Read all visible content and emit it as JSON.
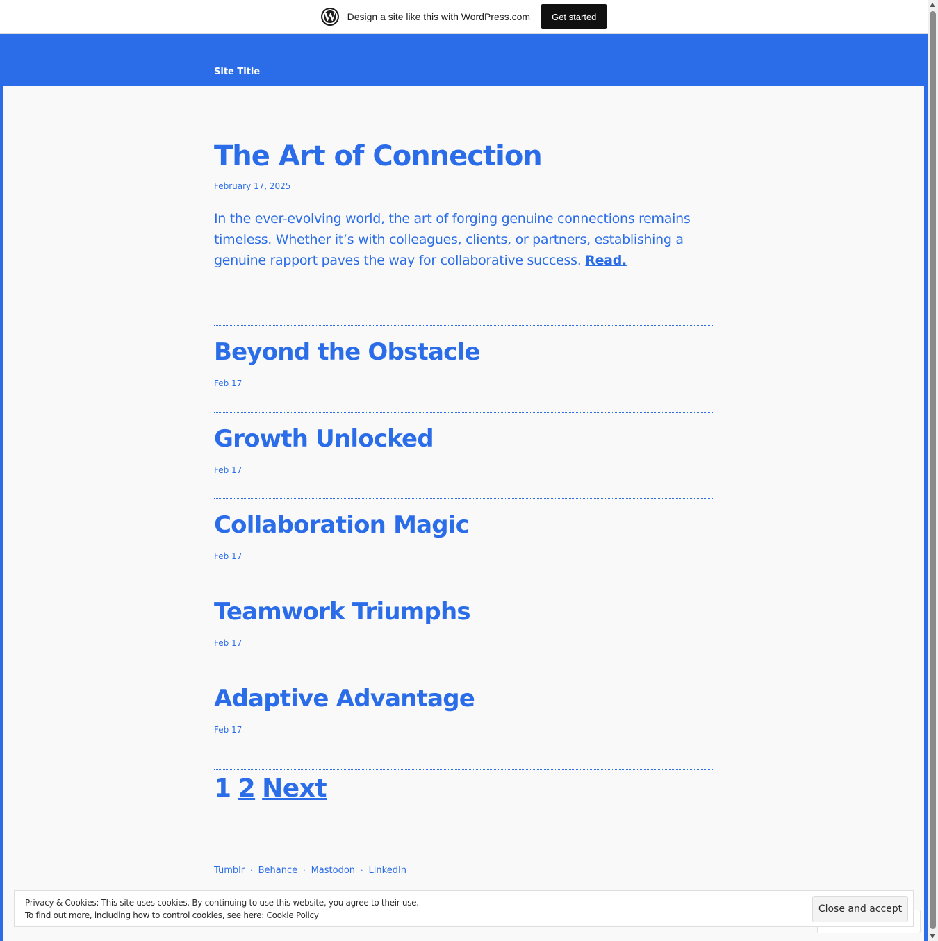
{
  "promo_bar": {
    "text": "Design a site like this with WordPress.com",
    "button_label": "Get started",
    "logo_glyph": "W"
  },
  "header": {
    "site_title": "Site Title"
  },
  "featured": {
    "title": "The Art of Connection",
    "date": "February 17, 2025",
    "excerpt": "In the ever-evolving world, the art of forging genuine connections remains timeless. Whether it’s with colleagues, clients, or partners, establishing a genuine rapport paves the way for collaborative success.",
    "read_label": "Read."
  },
  "posts": [
    {
      "title": "Beyond the Obstacle",
      "date": "Feb 17"
    },
    {
      "title": "Growth Unlocked",
      "date": "Feb 17"
    },
    {
      "title": "Collaboration Magic",
      "date": "Feb 17"
    },
    {
      "title": "Teamwork Triumphs",
      "date": "Feb 17"
    },
    {
      "title": "Adaptive Advantage",
      "date": "Feb 17"
    }
  ],
  "pagination": {
    "current": "1",
    "page2": "2",
    "next": "Next"
  },
  "social": {
    "links": [
      "Tumblr",
      "Behance",
      "Mastodon",
      "LinkedIn"
    ],
    "separator": "·"
  },
  "cookie": {
    "line1": "Privacy & Cookies: This site uses cookies. By continuing to use this website, you agree to their use.",
    "line2_prefix": "To find out more, including how to control cookies, see here: ",
    "policy_link": "Cookie Policy",
    "button_label": "Close and accept"
  },
  "colors": {
    "accent": "#2b6de8",
    "panel_background": "#f9f9f9",
    "promo_button": "#101010"
  }
}
